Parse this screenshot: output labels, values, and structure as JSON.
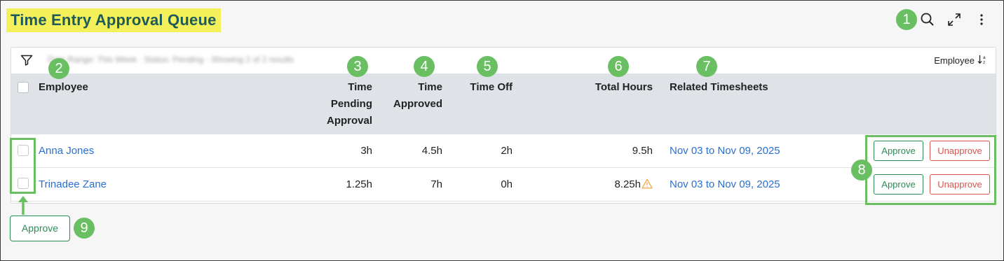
{
  "page": {
    "title": "Time Entry Approval Queue"
  },
  "filter_bar": {
    "active_filters_text": "Date Range: This Week · Status: Pending · Showing 2 of 2 results",
    "sort_label": "Employee",
    "sort_icon": "sort-az-icon"
  },
  "columns": {
    "employee": "Employee",
    "time_pending_line1": "Time",
    "time_pending_line2": "Pending",
    "time_pending_line3": "Approval",
    "time_approved_line1": "Time",
    "time_approved_line2": "Approved",
    "time_off": "Time Off",
    "total_hours": "Total Hours",
    "related_timesheets": "Related Timesheets"
  },
  "rows": [
    {
      "employee": "Anna Jones",
      "time_pending": "3h",
      "time_approved": "4.5h",
      "time_off": "2h",
      "total_hours": "9.5h",
      "warning": false,
      "related_timesheets": "Nov 03 to Nov 09, 2025",
      "approve_label": "Approve",
      "unapprove_label": "Unapprove"
    },
    {
      "employee": "Trinadee Zane",
      "time_pending": "1.25h",
      "time_approved": "7h",
      "time_off": "0h",
      "total_hours": "8.25h",
      "warning": true,
      "related_timesheets": "Nov 03 to Nov 09, 2025",
      "approve_label": "Approve",
      "unapprove_label": "Unapprove"
    }
  ],
  "bulk_action": {
    "approve_label": "Approve"
  },
  "callouts": [
    "1",
    "2",
    "3",
    "4",
    "5",
    "6",
    "7",
    "8",
    "9"
  ],
  "colors": {
    "title_highlight": "#f4f05a",
    "title_text": "#1d5b5b",
    "callout": "#6abf62",
    "link": "#2a6fd1",
    "approve": "#2e8b57",
    "unapprove": "#d9534f",
    "warning": "#f0ad4e"
  },
  "icons": {
    "search": "search-icon",
    "expand": "expand-icon",
    "more": "more-vertical-icon",
    "filter": "filter-icon",
    "warning": "warning-icon"
  }
}
